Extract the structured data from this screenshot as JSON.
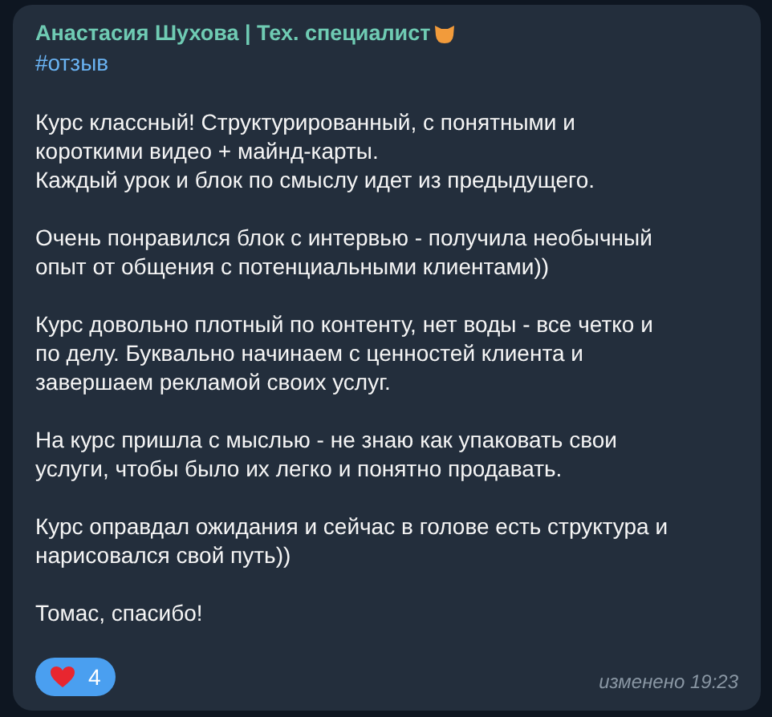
{
  "message": {
    "author": "Анастасия Шухова | Тех. специалист",
    "hashtag": "#отзыв",
    "paragraphs": [
      "Курс классный! Структурированный, с понятными и\nкороткими видео + майнд-карты.\nКаждый урок и блок по смыслу идет из предыдущего.",
      "Очень понравился блок с интервью - получила необычный\nопыт от общения с потенциальными клиентами))",
      "Курс довольно плотный по контенту, нет воды - все четко и\nпо делу. Буквально начинаем с ценностей клиента и\nзавершаем рекламой своих услуг.",
      "На курс пришла с мыслью - не знаю как упаковать свои\nуслуги, чтобы было их легко и понятно продавать.",
      "Курс оправдал ожидания и сейчас в голове есть структура и\nнарисовался свой путь))",
      "Томас, спасибо!"
    ],
    "reactions": [
      {
        "count": "4",
        "selected": true
      }
    ],
    "edited_time": "изменено 19:23"
  }
}
